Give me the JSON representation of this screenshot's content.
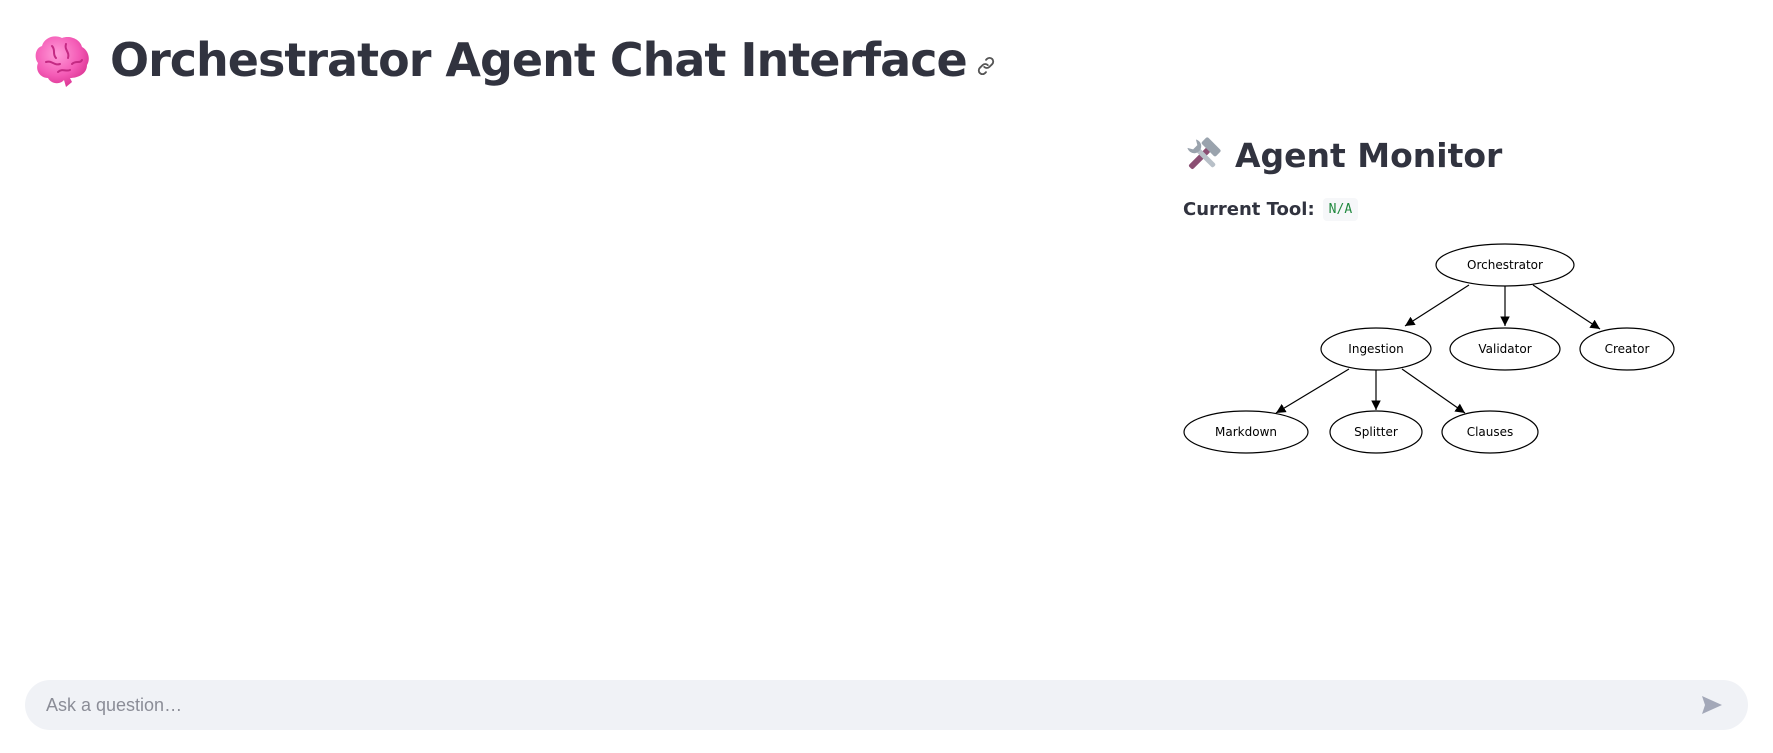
{
  "header": {
    "title": "Orchestrator Agent Chat Interface",
    "title_icon": "brain-icon",
    "anchor_icon": "link-icon"
  },
  "monitor": {
    "title": "Agent Monitor",
    "title_icon": "hammer-and-wrench-icon",
    "current_tool_label": "Current Tool:",
    "current_tool_value": "N/A"
  },
  "graph": {
    "nodes": {
      "orchestrator": "Orchestrator",
      "ingestion": "Ingestion",
      "validator": "Validator",
      "creator": "Creator",
      "markdown": "Markdown",
      "splitter": "Splitter",
      "clauses": "Clauses"
    }
  },
  "chat": {
    "placeholder": "Ask a question…",
    "value": "",
    "send_icon": "send-icon"
  },
  "colors": {
    "text": "#31333f",
    "code_text": "#21893f",
    "input_bg": "#f0f2f6"
  }
}
